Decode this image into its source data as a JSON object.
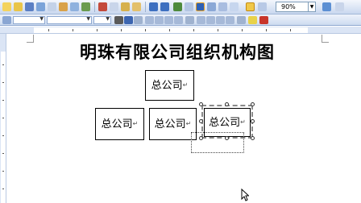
{
  "toolbar": {
    "zoom": "90%",
    "zoom_dropdown_icon": "chevron-down-icon"
  },
  "document": {
    "title": "明珠有限公司组织机构图",
    "paragraph_mark": "↵",
    "org_chart": {
      "top_box": "总公司",
      "bottom_boxes": [
        "总公司",
        "总公司",
        "总公司"
      ]
    }
  },
  "colors": {
    "toolbar_top": "#c9d8ef",
    "ruler": "#dbe5f5",
    "page": "#ffffff"
  }
}
